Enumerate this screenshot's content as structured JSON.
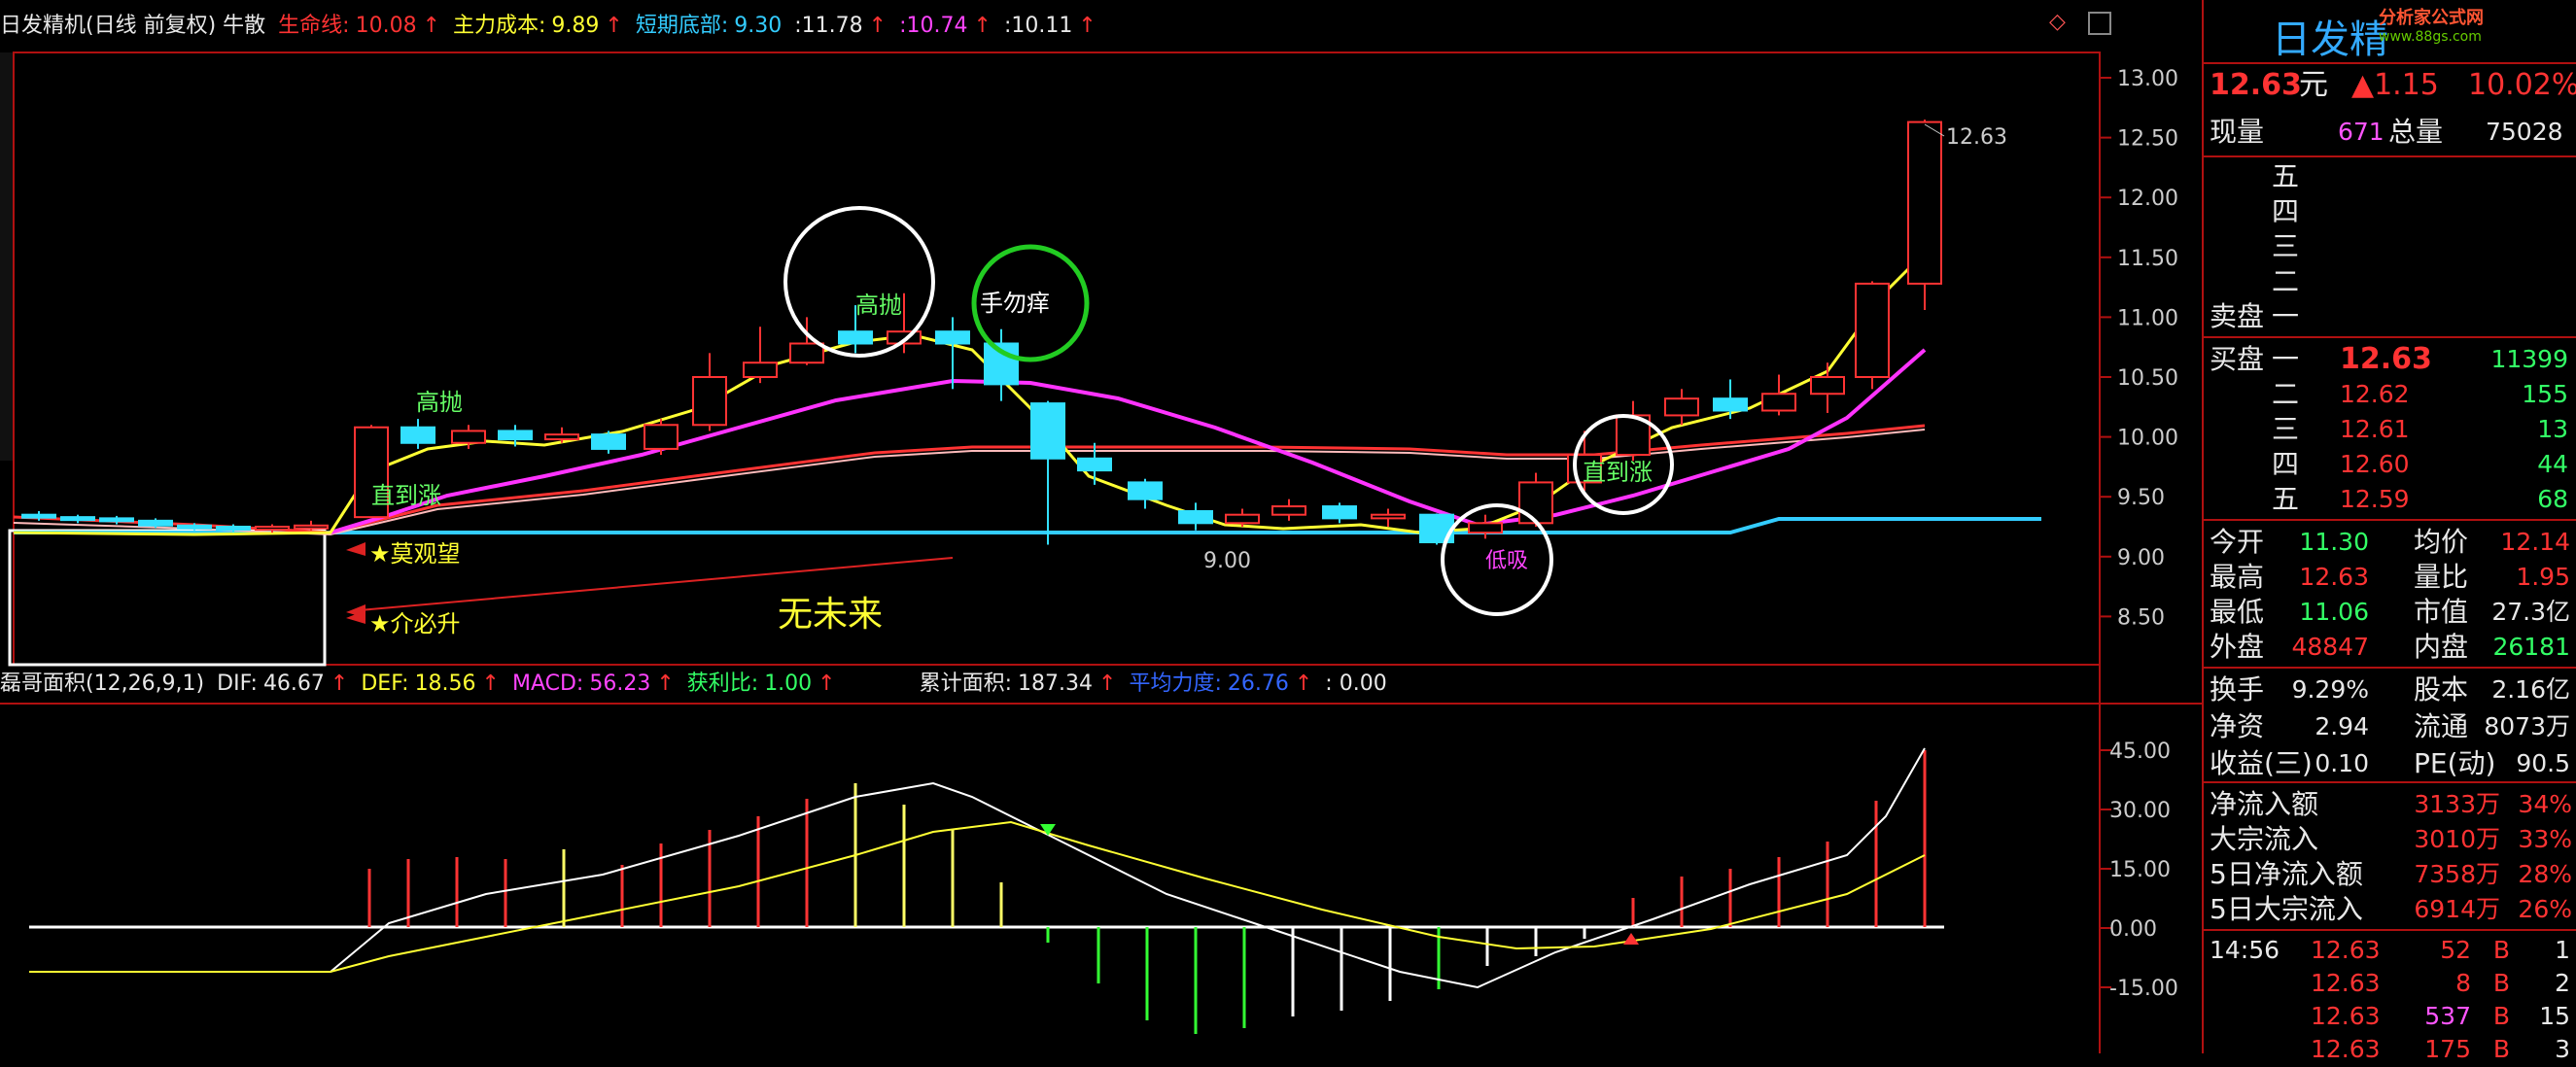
{
  "header": {
    "title": "日发精机(日线 前复权) 牛散",
    "lifeline_label": "生命线:",
    "lifeline_value": "10.08",
    "main_cost_label": "主力成本:",
    "main_cost_value": "9.89",
    "short_bottom_label": "短期底部:",
    "short_bottom_value": "9.30",
    "v1": ":11.78",
    "v2": ":10.74",
    "v3": ":10.11",
    "up_arrow": "↑"
  },
  "main_chart": {
    "y_ticks": [
      "13.00",
      "12.50",
      "12.00",
      "11.50",
      "11.00",
      "10.50",
      "10.00",
      "9.50",
      "9.00",
      "8.50"
    ],
    "price_tag": "12.63",
    "low_tag": "9.00",
    "annotations": {
      "gaopao1": "高抛",
      "gaopao2": "高抛",
      "zhidaozhang1": "直到涨",
      "zhidaozhang2": "直到涨",
      "shouwuyang": "手勿痒",
      "dixi": "低吸",
      "moguanwang": "★莫观望",
      "jiebisheng": "★介必升",
      "wuweilai": "无未来"
    }
  },
  "indicator_bar": {
    "name": "磊哥面积(12,26,9,1)",
    "dif_label": "DIF:",
    "dif_value": "46.67",
    "def_label": "DEF:",
    "def_value": "18.56",
    "macd_label": "MACD:",
    "macd_value": "56.23",
    "ratio_label": "获利比:",
    "ratio_value": "1.00",
    "cum_label": "累计面积:",
    "cum_value": "187.34",
    "avg_label": "平均力度:",
    "avg_value": "26.76",
    "zero": ": 0.00",
    "up_arrow": "↑"
  },
  "sub_chart": {
    "y_ticks": [
      "45.00",
      "30.00",
      "15.00",
      "0.00",
      "-15.00"
    ]
  },
  "panel": {
    "stock_name": "日发精",
    "logo": "分析家公式网",
    "logo_url_text": "www.88gs.com",
    "price": "12.63",
    "price_unit": "元",
    "change": "▲1.15",
    "change_pct": "10.02%",
    "xianliang_label": "现量",
    "xianliang": "671",
    "zongliang_label": "总量",
    "zongliang": "75028",
    "sell_levels": [
      "五",
      "四",
      "三",
      "二",
      "一"
    ],
    "sell_label": "卖盘",
    "buy_label": "买盘",
    "buy": [
      {
        "lvl": "一",
        "price": "12.63",
        "vol": "11399"
      },
      {
        "lvl": "二",
        "price": "12.62",
        "vol": "155"
      },
      {
        "lvl": "三",
        "price": "12.61",
        "vol": "13"
      },
      {
        "lvl": "四",
        "price": "12.60",
        "vol": "44"
      },
      {
        "lvl": "五",
        "price": "12.59",
        "vol": "68"
      }
    ],
    "stats1": [
      {
        "l1": "今开",
        "v1": "11.30",
        "c1": "g",
        "l2": "均价",
        "v2": "12.14",
        "c2": "r"
      },
      {
        "l1": "最高",
        "v1": "12.63",
        "c1": "r",
        "l2": "量比",
        "v2": "1.95",
        "c2": "r"
      },
      {
        "l1": "最低",
        "v1": "11.06",
        "c1": "g",
        "l2": "市值",
        "v2": "27.3亿",
        "c2": "w"
      },
      {
        "l1": "外盘",
        "v1": "48847",
        "c1": "r",
        "l2": "内盘",
        "v2": "26181",
        "c2": "g"
      }
    ],
    "stats2": [
      {
        "l1": "换手",
        "v1": "9.29%",
        "l2": "股本",
        "v2": "2.16亿"
      },
      {
        "l1": "净资",
        "v1": "2.94",
        "l2": "流通",
        "v2": "8073万"
      },
      {
        "l1": "收益(三)",
        "v1": "0.10",
        "l2": "PE(动)",
        "v2": "90.5"
      }
    ],
    "flows": [
      {
        "l": "净流入额",
        "v": "3133万",
        "p": "34%"
      },
      {
        "l": "大宗流入",
        "v": "3010万",
        "p": "33%"
      },
      {
        "l": "5日净流入额",
        "v": "7358万",
        "p": "28%"
      },
      {
        "l": "5日大宗流入",
        "v": "6914万",
        "p": "26%"
      }
    ],
    "ticks": [
      {
        "t": "14:56",
        "p": "12.63",
        "v": "52",
        "s": "B",
        "x": "1",
        "vc": "r"
      },
      {
        "t": "",
        "p": "12.63",
        "v": "8",
        "s": "B",
        "x": "2",
        "vc": "r"
      },
      {
        "t": "",
        "p": "12.63",
        "v": "537",
        "s": "B",
        "x": "15",
        "vc": "m"
      },
      {
        "t": "",
        "p": "12.63",
        "v": "175",
        "s": "B",
        "x": "3",
        "vc": "r"
      }
    ]
  },
  "colors": {
    "up": "#ff3333",
    "down": "#33e0ff",
    "ma_yellow": "#ffff33",
    "ma_magenta": "#ff33ff",
    "axis": "#b01010"
  }
}
